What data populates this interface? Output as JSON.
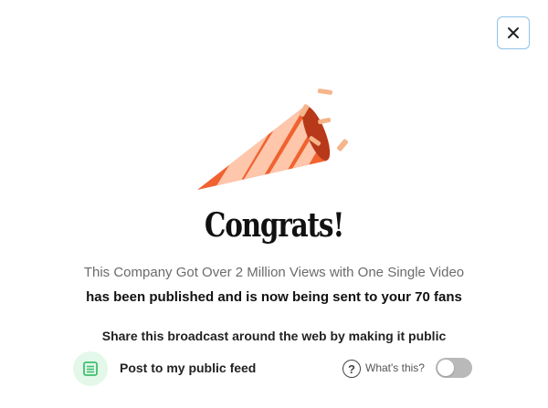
{
  "dialog": {
    "close_icon": "close-icon",
    "illustration": "party-popper",
    "title": "Congrats!",
    "post_title": "This Company Got Over 2 Million Views with One Single Video",
    "published_message": "has been published and is now being sent to your 70 fans",
    "share_prompt": "Share this broadcast around the web by making it public",
    "feed": {
      "icon": "feed-icon",
      "label": "Post to my public feed",
      "help_icon": "question-icon",
      "help_label": "What's this?",
      "public_toggle_on": false
    }
  },
  "colors": {
    "close_border": "#8fc3e8",
    "popper_orange": "#f0622f",
    "popper_stripe": "#ffd1b8",
    "feed_icon_bg": "#e3f8e9",
    "feed_icon_fg": "#3fbf6f",
    "toggle_off": "#b9b9b9"
  }
}
